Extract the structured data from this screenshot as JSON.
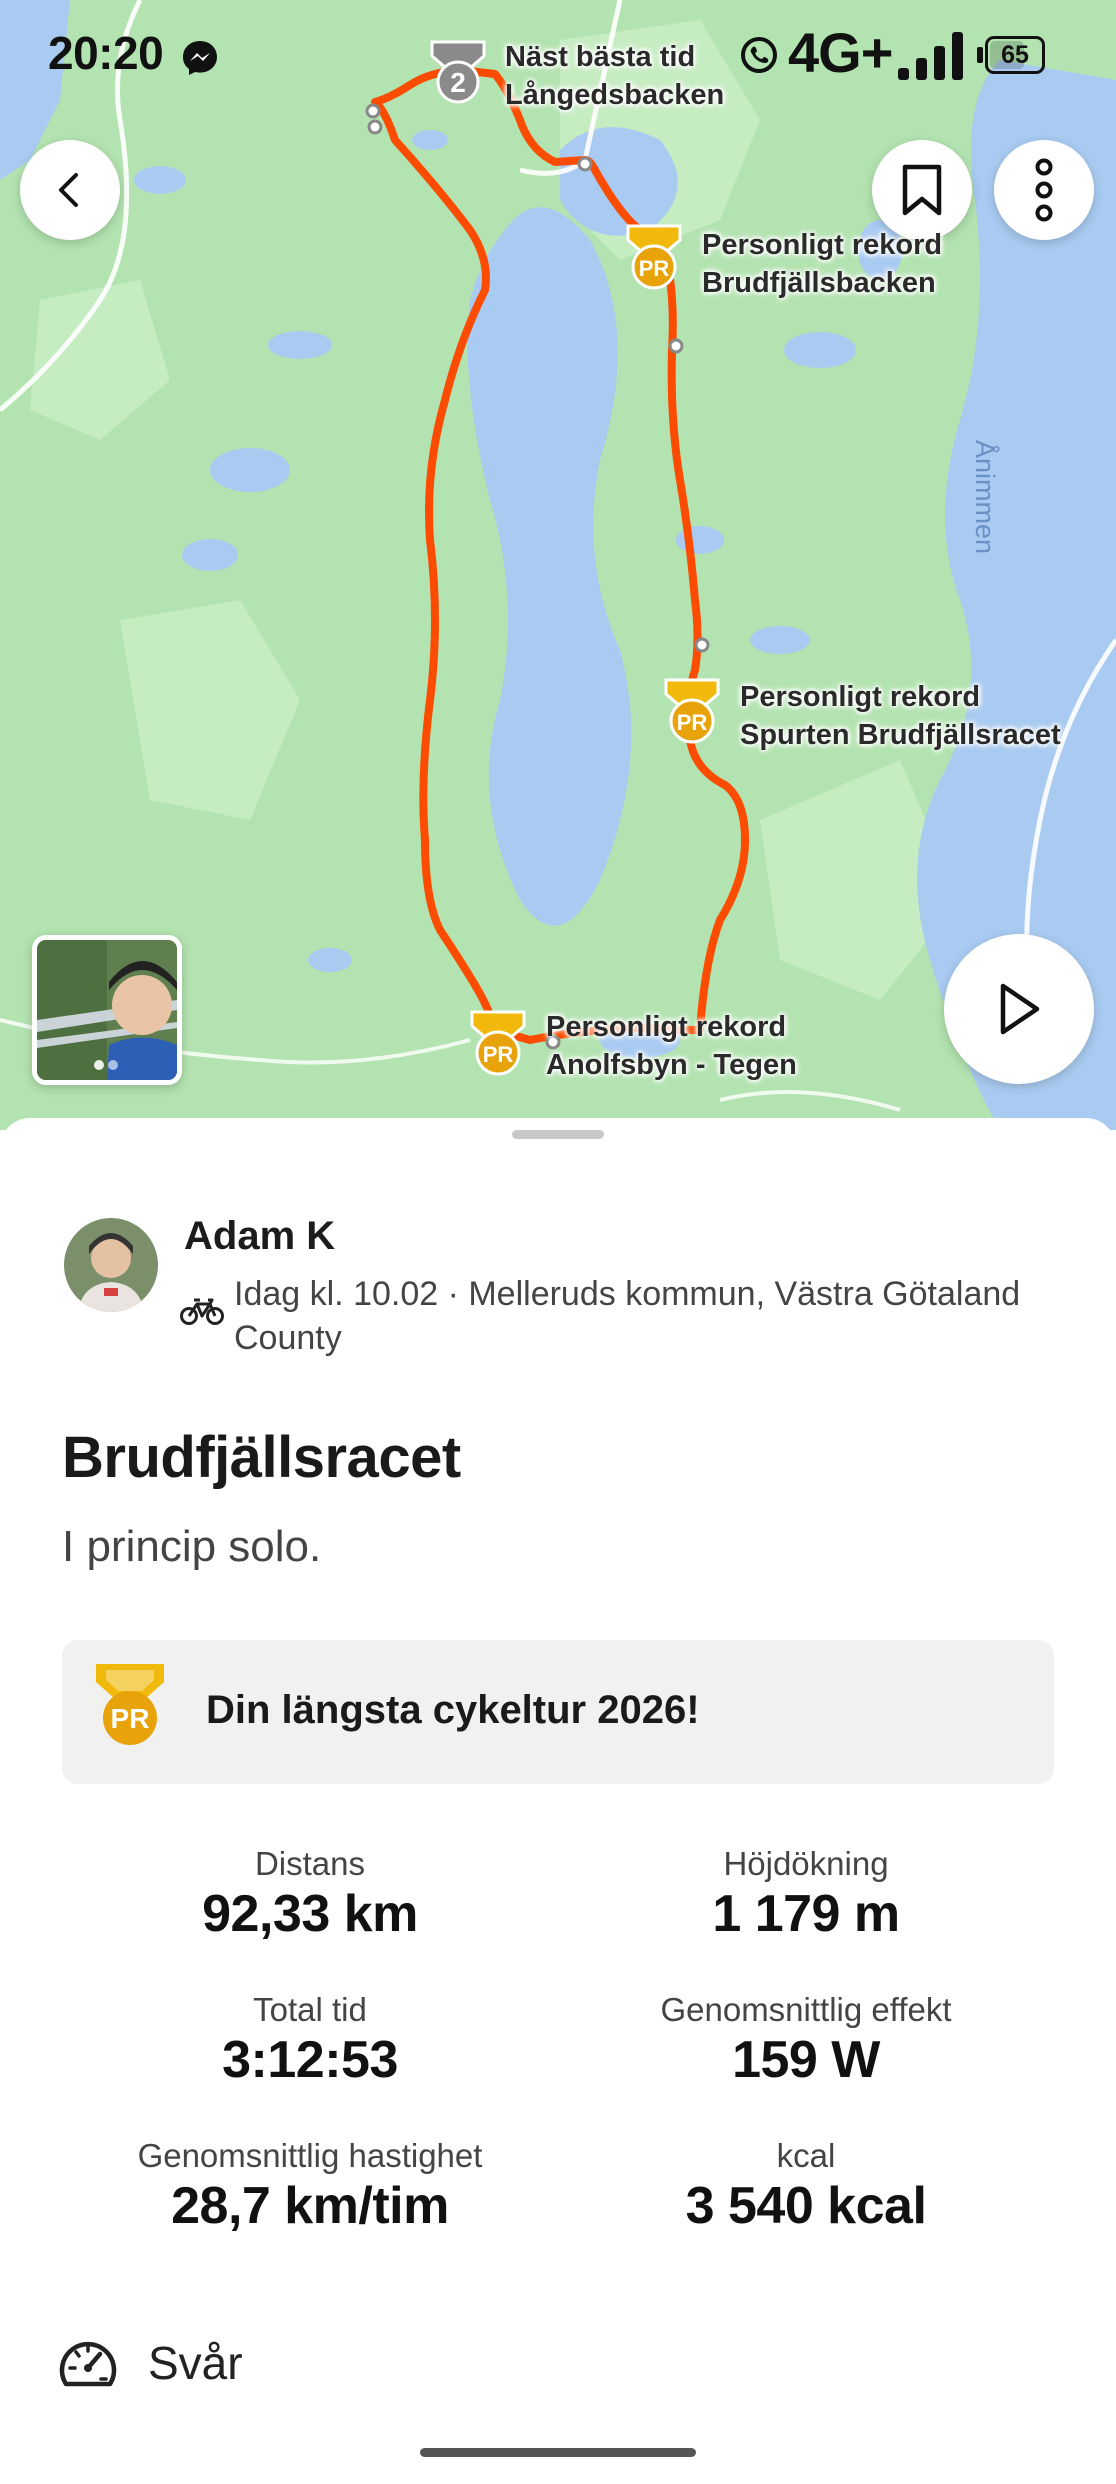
{
  "status_bar": {
    "time": "20:20",
    "network": "4G+",
    "battery": "65"
  },
  "map": {
    "labels": {
      "segment_top": [
        "Näst bästa tid",
        "Långedsbacken"
      ],
      "segment_pr1": [
        "Personligt rekord",
        "Brudfjällsbacken"
      ],
      "segment_pr2": [
        "Personligt rekord",
        "Spurten Brudfjällsracet"
      ],
      "segment_pr3": [
        "Personligt rekord",
        "Anolfsbyn - Tegen"
      ],
      "lake": "Ånimmen"
    },
    "medal_rank": "2",
    "pr_badge": "PR",
    "colors": {
      "route": "#fc4c02",
      "land": "#b3e3b0",
      "water": "#a9cbf1",
      "medal_gold": "#f0b90b"
    }
  },
  "athlete": {
    "name": "Adam K",
    "meta": "Idag kl. 10.02 · Melleruds kommun, Västra Götaland County"
  },
  "activity": {
    "title": "Brudfjällsracet",
    "description": "I princip solo.",
    "achievement": "Din längsta cykeltur 2026!"
  },
  "stats": {
    "distance": {
      "label": "Distans",
      "value": "92,33 km"
    },
    "elevation": {
      "label": "Höjdökning",
      "value": "1 179 m"
    },
    "time": {
      "label": "Total tid",
      "value": "3:12:53"
    },
    "power": {
      "label": "Genomsnittlig effekt",
      "value": "159 W"
    },
    "speed": {
      "label": "Genomsnittlig hastighet",
      "value": "28,7 km/tim"
    },
    "kcal": {
      "label": "kcal",
      "value": "3 540 kcal"
    }
  },
  "effort": {
    "label": "Svår"
  }
}
